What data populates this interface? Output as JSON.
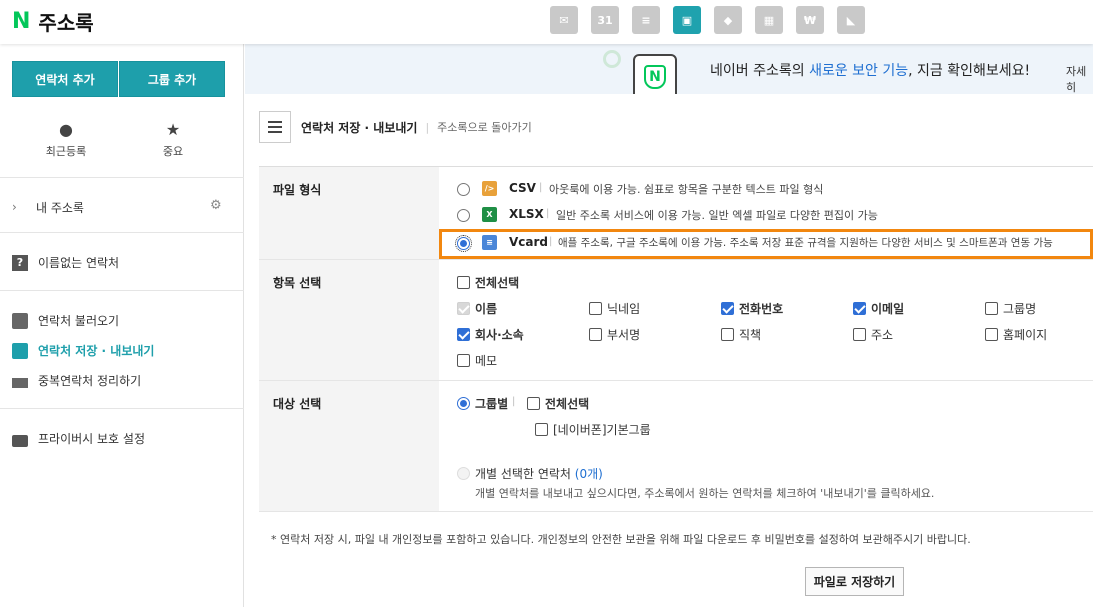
{
  "app": {
    "logo": "N",
    "title": "주소록"
  },
  "top_icons": [
    {
      "name": "mail-icon",
      "glyph": "✉"
    },
    {
      "name": "calendar-icon",
      "glyph": "31"
    },
    {
      "name": "list-icon",
      "glyph": "≡"
    },
    {
      "name": "contacts-icon",
      "glyph": "▣"
    },
    {
      "name": "cube-icon",
      "glyph": "◆"
    },
    {
      "name": "grid-icon",
      "glyph": "▦"
    },
    {
      "name": "won-icon",
      "glyph": "₩"
    },
    {
      "name": "flag-icon",
      "glyph": "◣"
    }
  ],
  "sidebar": {
    "add_contact": "연락처 추가",
    "add_group": "그룹 추가",
    "recent": "최근등록",
    "important": "중요",
    "my_address_book": "내 주소록",
    "unnamed": "이름없는 연락처",
    "import": "연락처 불러오기",
    "export": "연락처 저장 · 내보내기",
    "dedupe": "중복연락처 정리하기",
    "privacy": "프라이버시 보호 설정"
  },
  "banner": {
    "prefix": "네이버 주소록의 ",
    "highlight": "새로운 보안 기능",
    "suffix": ", 지금 확인해보세요!",
    "more": "자세히"
  },
  "header": {
    "title": "연락처 저장 · 내보내기",
    "back": "주소록으로 돌아가기"
  },
  "file_format": {
    "label": "파일 형식",
    "options": [
      {
        "name": "CSV",
        "desc": "아웃룩에 이용 가능. 쉼표로 항목을 구분한 텍스트 파일 형식",
        "selected": false
      },
      {
        "name": "XLSX",
        "desc": "일반 주소록 서비스에 이용 가능. 일반 엑셀 파일로 다양한 편집이 가능",
        "selected": false
      },
      {
        "name": "Vcard",
        "desc": "애플 주소록, 구글 주소록에 이용 가능. 주소록 저장 표준 규격을 지원하는 다양한 서비스 및 스마트폰과 연동 가능",
        "selected": true
      }
    ]
  },
  "fields": {
    "label": "항목 선택",
    "select_all": "전체선택",
    "items": [
      {
        "label": "이름",
        "checked": true,
        "disabled": true
      },
      {
        "label": "닉네임",
        "checked": false
      },
      {
        "label": "전화번호",
        "checked": true
      },
      {
        "label": "이메일",
        "checked": true
      },
      {
        "label": "그룹명",
        "checked": false
      },
      {
        "label": "회사·소속",
        "checked": true
      },
      {
        "label": "부서명",
        "checked": false
      },
      {
        "label": "직책",
        "checked": false
      },
      {
        "label": "주소",
        "checked": false
      },
      {
        "label": "홈페이지",
        "checked": false
      },
      {
        "label": "메모",
        "checked": false
      }
    ]
  },
  "target": {
    "label": "대상 선택",
    "by_group": "그룹별",
    "select_all": "전체선택",
    "group_default": "[네이버폰]기본그룹",
    "individual": "개별 선택한 연락처",
    "individual_count": "(0개)",
    "individual_note": "개별 연락처를 내보내고 싶으시다면, 주소록에서 원하는 연락처를 체크하여 '내보내기'를 클릭하세요."
  },
  "notice": "* 연락처 저장 시, 파일 내 개인정보를 포함하고 있습니다. 개인정보의 안전한 보관을 위해 파일 다운로드 후 비밀번호를 설정하여 보관해주시기 바랍니다.",
  "save_button": "파일로 저장하기",
  "colors": {
    "accent": "#1e9fab",
    "highlight": "#f2870f",
    "link": "#1f6fd1",
    "naver_green": "#03c75a"
  }
}
